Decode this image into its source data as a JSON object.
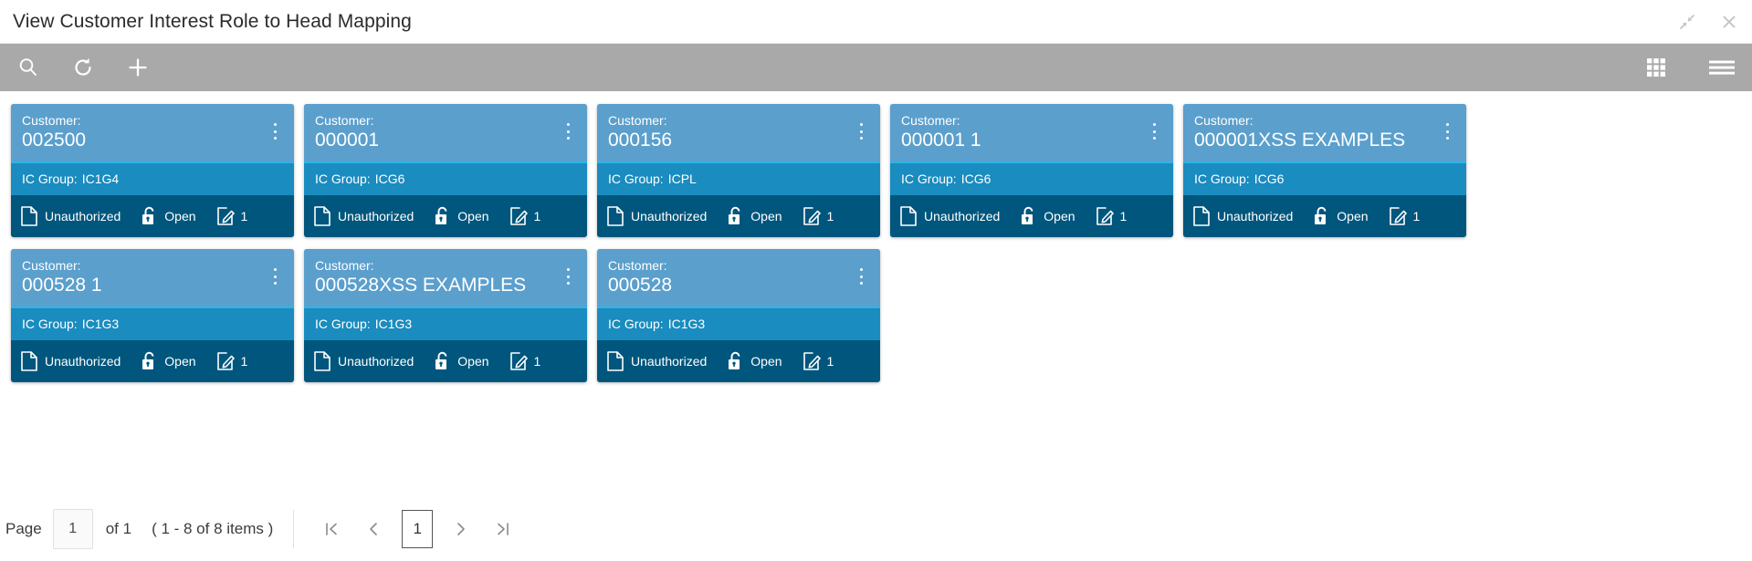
{
  "window": {
    "title": "View Customer Interest Role to Head Mapping",
    "minimize_icon": "collapse-arrows-icon",
    "close_icon": "close-icon"
  },
  "toolbar": {
    "left_actions": [
      {
        "name": "search-button",
        "icon": "search-icon"
      },
      {
        "name": "refresh-button",
        "icon": "refresh-icon"
      },
      {
        "name": "add-button",
        "icon": "plus-icon"
      }
    ],
    "right_actions": [
      {
        "name": "grid-view-button",
        "icon": "grid-icon"
      },
      {
        "name": "list-view-button",
        "icon": "hamburger-icon"
      }
    ]
  },
  "card_labels": {
    "customer": "Customer:",
    "ic_group": "IC Group:"
  },
  "cards": [
    {
      "customer": "002500",
      "ic_group": "IC1G4",
      "auth_status": "Unauthorized",
      "lock_status": "Open",
      "version": "1"
    },
    {
      "customer": "000001",
      "ic_group": "ICG6",
      "auth_status": "Unauthorized",
      "lock_status": "Open",
      "version": "1"
    },
    {
      "customer": "000156",
      "ic_group": "ICPL",
      "auth_status": "Unauthorized",
      "lock_status": "Open",
      "version": "1"
    },
    {
      "customer": "000001 1",
      "ic_group": "ICG6",
      "auth_status": "Unauthorized",
      "lock_status": "Open",
      "version": "1"
    },
    {
      "customer": "000001XSS EXAMPLES",
      "ic_group": "ICG6",
      "auth_status": "Unauthorized",
      "lock_status": "Open",
      "version": "1"
    },
    {
      "customer": "000528 1",
      "ic_group": "IC1G3",
      "auth_status": "Unauthorized",
      "lock_status": "Open",
      "version": "1"
    },
    {
      "customer": "000528XSS EXAMPLES",
      "ic_group": "IC1G3",
      "auth_status": "Unauthorized",
      "lock_status": "Open",
      "version": "1"
    },
    {
      "customer": "000528",
      "ic_group": "IC1G3",
      "auth_status": "Unauthorized",
      "lock_status": "Open",
      "version": "1"
    }
  ],
  "pagination": {
    "page_label": "Page",
    "page_value": "1",
    "of_text": "of 1",
    "items_text": "( 1 - 8 of 8 items )",
    "current_page": "1",
    "first_icon": "first-page-icon",
    "prev_icon": "prev-page-icon",
    "next_icon": "next-page-icon",
    "last_icon": "last-page-icon"
  },
  "colors": {
    "toolbar_bg": "#a9a9a9",
    "card_header_bg": "#5b9fcd",
    "card_accent": "#29b6e8",
    "card_group_bg": "#1a8cbf",
    "card_footer_bg": "#00567d"
  }
}
